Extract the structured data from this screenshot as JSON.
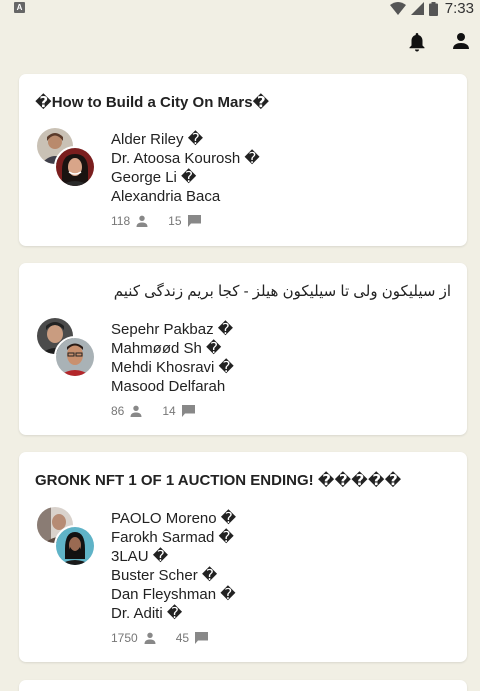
{
  "status_bar": {
    "left_icon": "A",
    "time": "7:33"
  },
  "toolbar": {
    "notifications_icon": "bell-icon",
    "profile_icon": "person-icon"
  },
  "rooms": [
    {
      "title": "�How to Build a City On Mars�",
      "speakers": [
        "Alder Riley �",
        "Dr. Atoosa Kourosh �",
        "George Li �",
        "Alexandria Baca"
      ],
      "listeners": "118",
      "messages": "15"
    },
    {
      "title": "از سیلیکون ولی تا سیلیکون هیلز - کجا بریم زندگی کنیم",
      "speakers": [
        "Sepehr Pakbaz �",
        "Mahmøød Sh �",
        "Mehdi Khosravi �",
        "Masood Delfarah"
      ],
      "listeners": "86",
      "messages": "14"
    },
    {
      "title": "GRONK NFT 1 OF 1 AUCTION ENDING! �����",
      "speakers": [
        "PAOLO Moreno �",
        "Farokh Sarmad �",
        "3LAU �",
        "Buster Scher �",
        "Dan Fleyshman �",
        "Dr. Aditi �"
      ],
      "listeners": "1750",
      "messages": "45"
    }
  ]
}
